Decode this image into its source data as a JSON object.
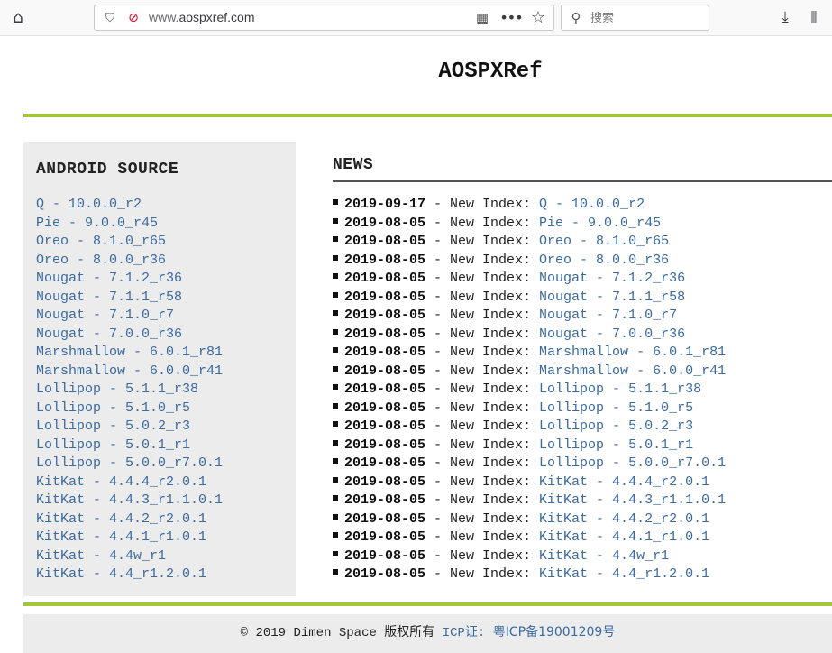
{
  "browser": {
    "url_prefix": "www.",
    "url_domain": "aospxref.com",
    "search_placeholder": "搜索",
    "icons": [
      "home-icon",
      "shield-icon",
      "insecure-lock-icon",
      "qr-code-icon",
      "more-icon",
      "bookmark-star-icon",
      "search-icon",
      "download-icon",
      "library-icon"
    ]
  },
  "site": {
    "title": "AOSPXRef",
    "accent_color": "#a4c639",
    "link_color": "#3a6aa0"
  },
  "sidebar": {
    "heading": "ANDROID SOURCE",
    "items": [
      "Q - 10.0.0_r2",
      "Pie - 9.0.0_r45",
      "Oreo - 8.1.0_r65",
      "Oreo - 8.0.0_r36",
      "Nougat - 7.1.2_r36",
      "Nougat - 7.1.1_r58",
      "Nougat - 7.1.0_r7",
      "Nougat - 7.0.0_r36",
      "Marshmallow - 6.0.1_r81",
      "Marshmallow - 6.0.0_r41",
      "Lollipop - 5.1.1_r38",
      "Lollipop - 5.1.0_r5",
      "Lollipop - 5.0.2_r3",
      "Lollipop - 5.0.1_r1",
      "Lollipop - 5.0.0_r7.0.1",
      "KitKat - 4.4.4_r2.0.1",
      "KitKat - 4.4.3_r1.1.0.1",
      "KitKat - 4.4.2_r2.0.1",
      "KitKat - 4.4.1_r1.0.1",
      "KitKat - 4.4w_r1",
      "KitKat - 4.4_r1.2.0.1"
    ]
  },
  "news": {
    "heading": "NEWS",
    "label": " - New Index: ",
    "items": [
      {
        "date": "2019-09-17",
        "link": "Q - 10.0.0_r2"
      },
      {
        "date": "2019-08-05",
        "link": "Pie - 9.0.0_r45"
      },
      {
        "date": "2019-08-05",
        "link": "Oreo - 8.1.0_r65"
      },
      {
        "date": "2019-08-05",
        "link": "Oreo - 8.0.0_r36"
      },
      {
        "date": "2019-08-05",
        "link": "Nougat - 7.1.2_r36"
      },
      {
        "date": "2019-08-05",
        "link": "Nougat - 7.1.1_r58"
      },
      {
        "date": "2019-08-05",
        "link": "Nougat - 7.1.0_r7"
      },
      {
        "date": "2019-08-05",
        "link": "Nougat - 7.0.0_r36"
      },
      {
        "date": "2019-08-05",
        "link": "Marshmallow - 6.0.1_r81"
      },
      {
        "date": "2019-08-05",
        "link": "Marshmallow - 6.0.0_r41"
      },
      {
        "date": "2019-08-05",
        "link": "Lollipop - 5.1.1_r38"
      },
      {
        "date": "2019-08-05",
        "link": "Lollipop - 5.1.0_r5"
      },
      {
        "date": "2019-08-05",
        "link": "Lollipop - 5.0.2_r3"
      },
      {
        "date": "2019-08-05",
        "link": "Lollipop - 5.0.1_r1"
      },
      {
        "date": "2019-08-05",
        "link": "Lollipop - 5.0.0_r7.0.1"
      },
      {
        "date": "2019-08-05",
        "link": "KitKat - 4.4.4_r2.0.1"
      },
      {
        "date": "2019-08-05",
        "link": "KitKat - 4.4.3_r1.1.0.1"
      },
      {
        "date": "2019-08-05",
        "link": "KitKat - 4.4.2_r2.0.1"
      },
      {
        "date": "2019-08-05",
        "link": "KitKat - 4.4.1_r1.0.1"
      },
      {
        "date": "2019-08-05",
        "link": "KitKat - 4.4w_r1"
      },
      {
        "date": "2019-08-05",
        "link": "KitKat - 4.4_r1.2.0.1"
      }
    ]
  },
  "footer": {
    "copyright": "© 2019 Dimen Space ",
    "rights": "版权所有",
    "icp_label": "ICP证: ",
    "icp_number": "粤ICP备19001209号"
  }
}
